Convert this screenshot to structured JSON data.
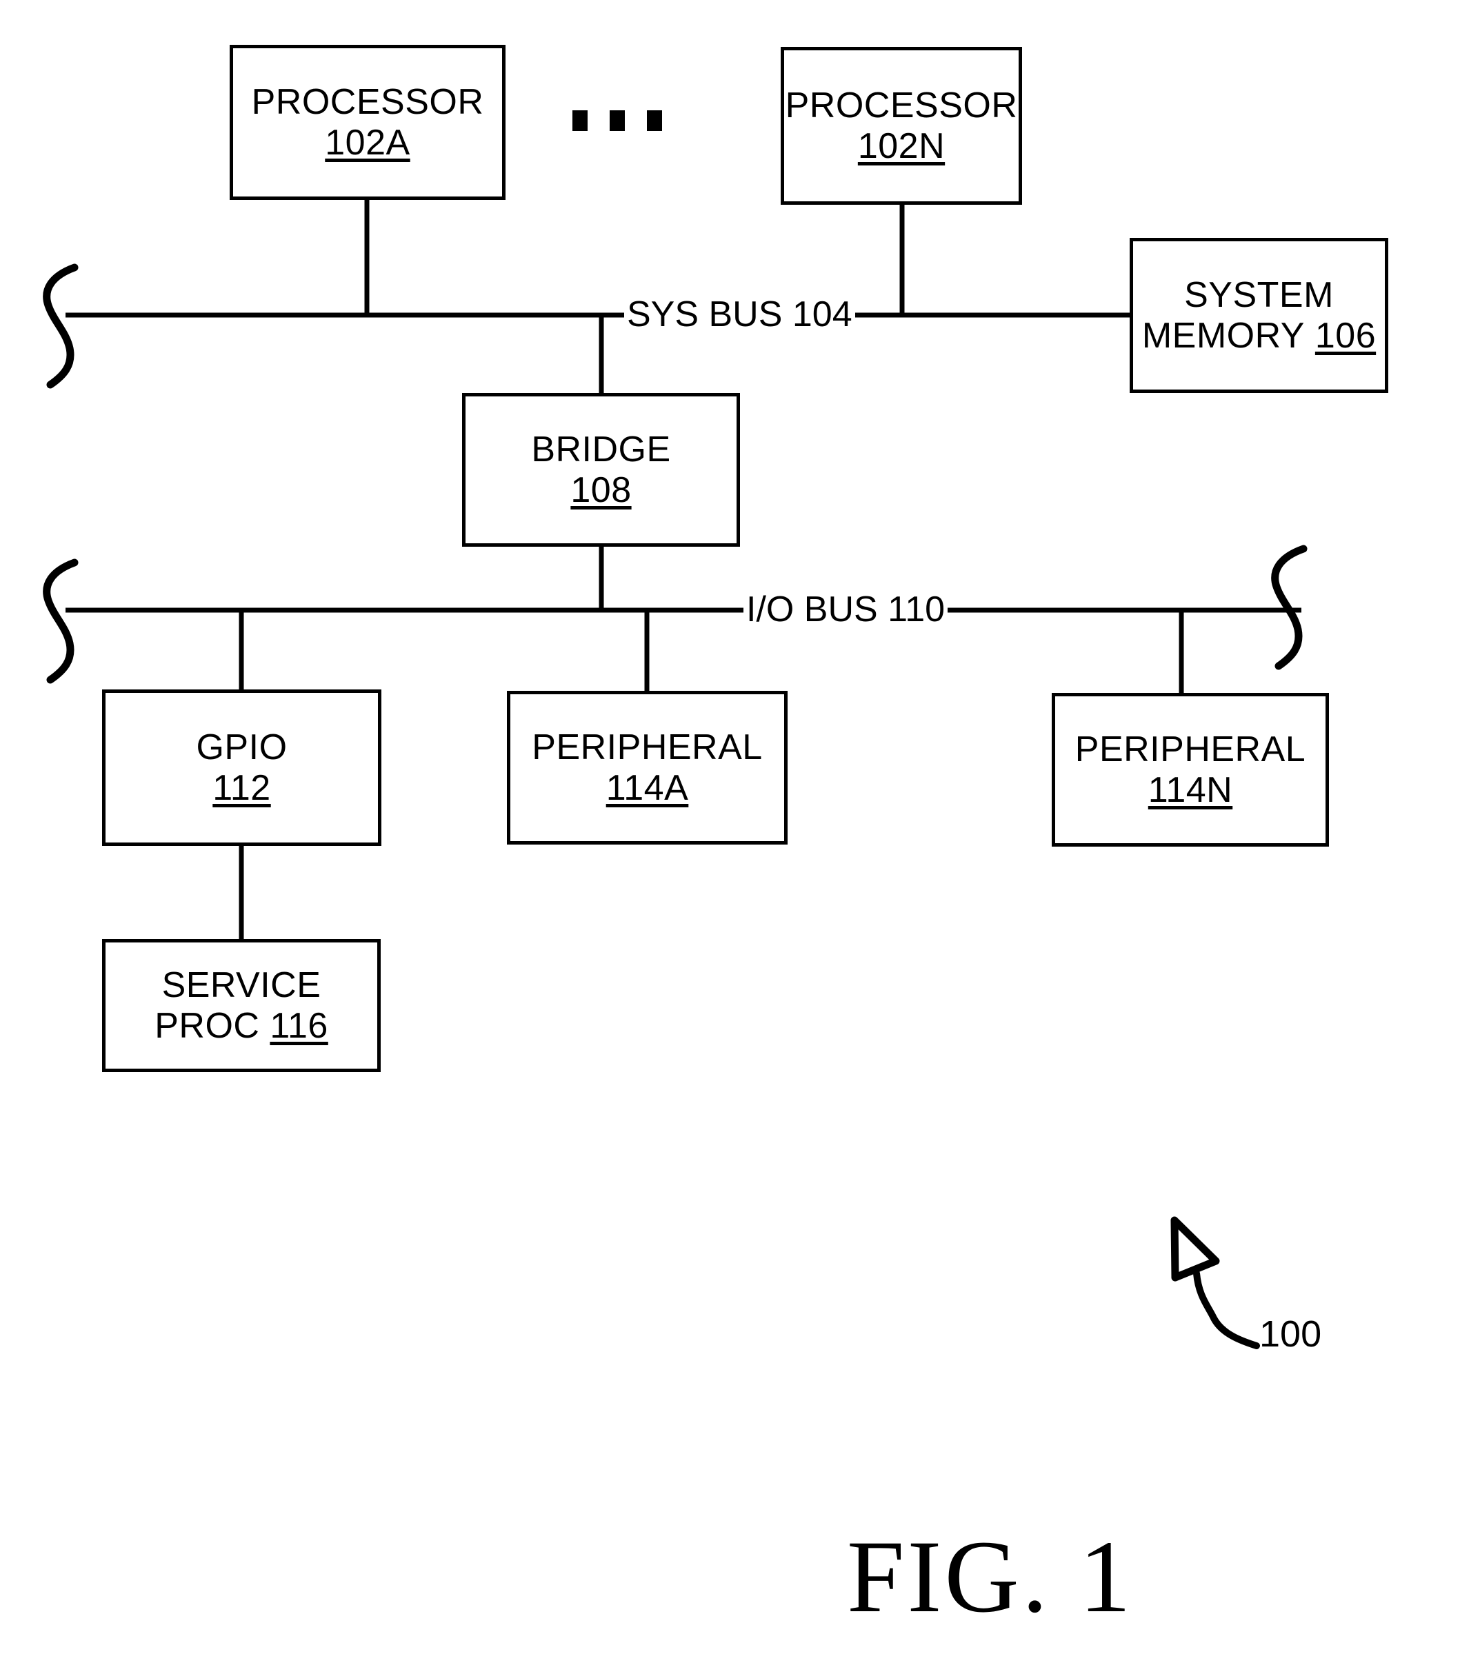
{
  "figure": {
    "caption": "FIG. 1",
    "ref_number": "100",
    "ellipsis": "• • •"
  },
  "nodes": [
    {
      "id": "processor-a",
      "title": "PROCESSOR",
      "number": "102A"
    },
    {
      "id": "processor-n",
      "title": "PROCESSOR",
      "number": "102N"
    },
    {
      "id": "system-memory",
      "title": "SYSTEM",
      "number": "MEMORY 106",
      "number_underline_part": "106"
    },
    {
      "id": "bridge",
      "title": "BRIDGE",
      "number": "108"
    },
    {
      "id": "gpio",
      "title": "GPIO",
      "number": "112"
    },
    {
      "id": "peripheral-a",
      "title": "PERIPHERAL",
      "number": "114A"
    },
    {
      "id": "peripheral-n",
      "title": "PERIPHERAL",
      "number": "114N"
    },
    {
      "id": "service-proc",
      "title": "SERVICE",
      "number": "PROC 116",
      "number_underline_part": "116"
    }
  ],
  "buses": [
    {
      "id": "sys-bus",
      "label": "SYS BUS 104"
    },
    {
      "id": "io-bus",
      "label": "I/O BUS 110"
    }
  ],
  "colors": {
    "ink": "#000000",
    "paper": "#ffffff"
  }
}
